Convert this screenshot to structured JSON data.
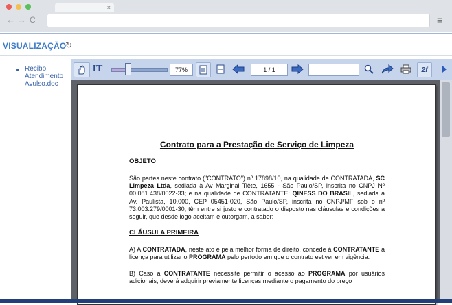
{
  "browser": {
    "dots": [
      "#ec5e57",
      "#f5bf4f",
      "#5ac05a"
    ],
    "tab_close": "×",
    "back": "←",
    "forward": "→",
    "reload": "C",
    "menu": "≡"
  },
  "header": {
    "title": "VISUALIZAÇÃO",
    "refresh_icon": "↻"
  },
  "sidebar": {
    "items": [
      {
        "label": "Recibo Atendimento Avulso.doc"
      }
    ]
  },
  "toolbar": {
    "zoom": "77%",
    "page_indicator": "1 / 1",
    "search_value": ""
  },
  "document": {
    "title": "Contrato para a Prestação de Serviço de Limpeza",
    "sections": {
      "objeto": "OBJETO",
      "clausula": "CLÁUSULA PRIMEIRA"
    },
    "p1": {
      "a": "São partes neste contrato (\"CONTRATO\") nº 17898/10, na qualidade de CONTRATADA, ",
      "b": "SC Limpeza Ltda",
      "c": ", sediada à Av Marginal Tiête, 1655 - São Paulo/SP, inscrita no CNPJ Nº 00.081.438/0022-33; e na qualidade de CONTRATANTE: ",
      "d": "QINESS DO BRASIL",
      "e": ", sediada à Av. Paulista, 10.000, CEP 05451-020, São Paulo/SP, inscrita no CNPJ/MF sob o nº 73.003.279/0001-30, têm entre si justo e contratado o disposto nas cláusulas e condições a seguir, que desde logo aceitam e outorgam, a saber:"
    },
    "pa": {
      "a": "A) A ",
      "b": "CONTRATADA",
      "c": ", neste ato e pela melhor forma de direito, concede à ",
      "d": "CONTRATANTE",
      "e": " a licença para utilizar o ",
      "f": "PROGRAMA",
      "g": " pelo período em que o contrato estiver em vigência."
    },
    "pb": {
      "a": "B) Caso a ",
      "b": "CONTRATANTE",
      "c": " necessite permitir o acesso ao ",
      "d": "PROGRAMA",
      "e": " por usuários adicionais, deverá adquirir previamente licenças mediante o pagamento do preço"
    }
  }
}
